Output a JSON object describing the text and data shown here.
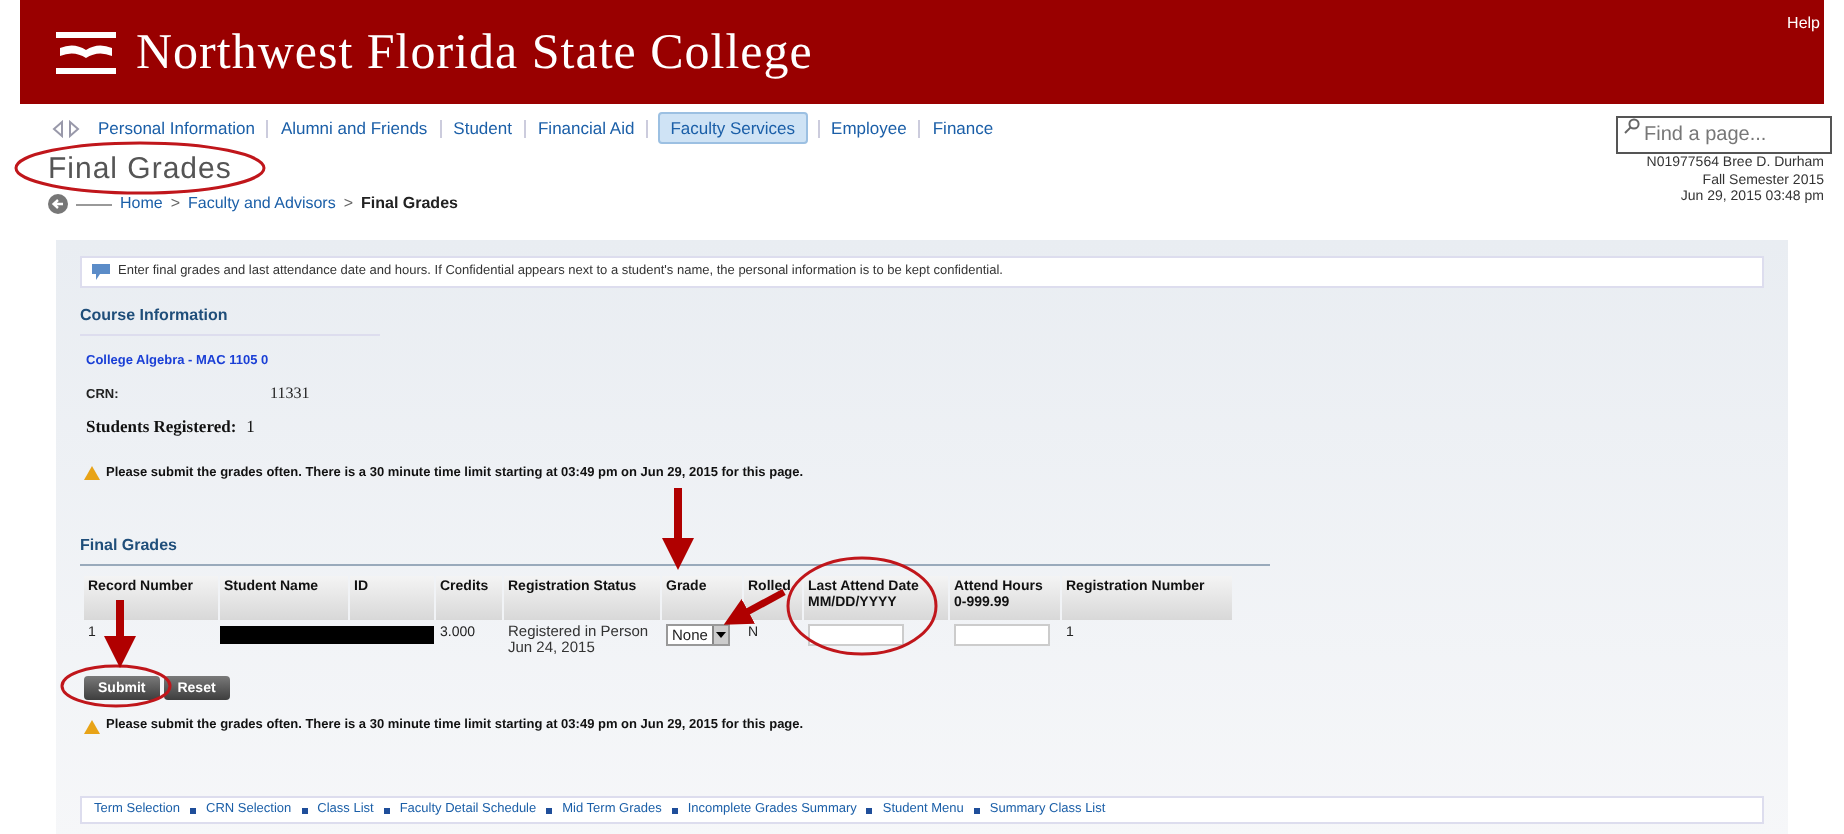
{
  "header": {
    "college": "Northwest Florida State College",
    "help": "Help"
  },
  "nav": {
    "tabs": [
      {
        "label": "Personal Information",
        "selected": false
      },
      {
        "label": "Alumni and Friends",
        "selected": false
      },
      {
        "label": "Student",
        "selected": false
      },
      {
        "label": "Financial Aid",
        "selected": false
      },
      {
        "label": "Faculty Services",
        "selected": true
      },
      {
        "label": "Employee",
        "selected": false
      },
      {
        "label": "Finance",
        "selected": false
      }
    ],
    "search": {
      "placeholder": "Find a page..."
    }
  },
  "page_title": "Final Grades",
  "breadcrumb": [
    {
      "label": "Home"
    },
    {
      "separator": ">",
      "label": "Faculty and Advisors"
    },
    {
      "separator": ">",
      "label": "Final Grades"
    }
  ],
  "user_info": [
    "N01977564 Bree D. Durham",
    "Fall Semester 2015",
    "Jun 29, 2015 03:48 pm"
  ],
  "info_message": "Enter final grades and last attendance date and hours. If Confidential appears next to a student's name, the personal information is to be kept confidential.",
  "course_information": {
    "heading": "Course Information",
    "course": "College Algebra - MAC 1105 0",
    "crn_label": "CRN:",
    "crn": "11331",
    "registered_label": "Students Registered:",
    "registered": "1"
  },
  "warnings": [
    "Please submit the grades often. There is a 30 minute time limit starting at 03:49 pm on Jun 29, 2015 for this page.",
    "Please submit the grades often. There is a 30 minute time limit starting at 03:49 pm on Jun 29, 2015 for this page."
  ],
  "final_grades": {
    "heading": "Final Grades",
    "columns": [
      {
        "label": "Record Number"
      },
      {
        "label": "Student Name"
      },
      {
        "label": "ID"
      },
      {
        "label": "Credits"
      },
      {
        "label": "Registration Status"
      },
      {
        "label": "Grade"
      },
      {
        "label": "Rolled"
      },
      {
        "label": "Last Attend Date",
        "sublabel": "MM/DD/YYYY"
      },
      {
        "label": "Attend Hours",
        "sublabel": "0-999.99"
      },
      {
        "label": "Registration Number"
      }
    ],
    "rows": [
      {
        "record_number": "1",
        "credits": "3.000",
        "registration_status": "Registered in Person",
        "registration_date": "Jun 24, 2015",
        "grade": "None",
        "rolled": "N",
        "registration_number": "1"
      }
    ]
  },
  "buttons": [
    "Submit",
    "Reset"
  ],
  "footer_links": [
    "Term Selection",
    "CRN Selection",
    "Class List",
    "Faculty Detail Schedule",
    "Mid Term Grades",
    "Incomplete Grades Summary",
    "Student Menu",
    "Summary Class List"
  ]
}
